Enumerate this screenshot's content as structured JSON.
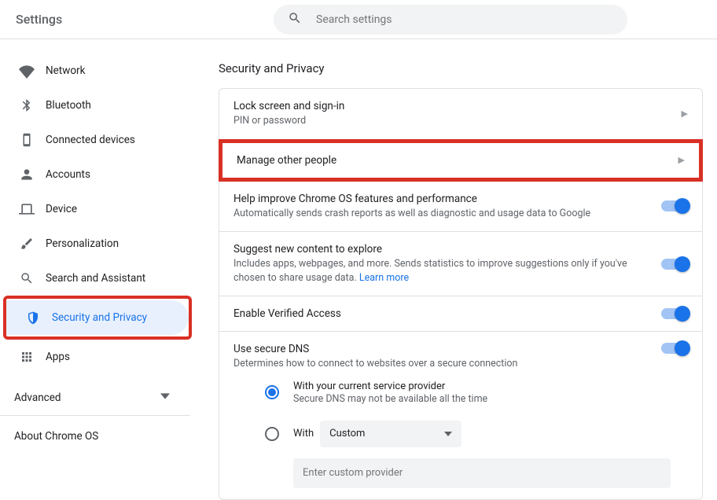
{
  "header": {
    "title": "Settings",
    "search_placeholder": "Search settings"
  },
  "sidebar": {
    "items": [
      {
        "label": "Network"
      },
      {
        "label": "Bluetooth"
      },
      {
        "label": "Connected devices"
      },
      {
        "label": "Accounts"
      },
      {
        "label": "Device"
      },
      {
        "label": "Personalization"
      },
      {
        "label": "Search and Assistant"
      },
      {
        "label": "Security and Privacy"
      },
      {
        "label": "Apps"
      }
    ],
    "advanced": "Advanced",
    "about": "About Chrome OS"
  },
  "section_title": "Security and Privacy",
  "rows": {
    "lock": {
      "title": "Lock screen and sign-in",
      "sub": "PIN or password"
    },
    "manage": {
      "title": "Manage other people"
    },
    "improve": {
      "title": "Help improve Chrome OS features and performance",
      "sub": "Automatically sends crash reports as well as diagnostic and usage data to Google"
    },
    "suggest": {
      "title": "Suggest new content to explore",
      "sub": "Includes apps, webpages, and more. Sends statistics to improve suggestions only if you've chosen to share usage data.  ",
      "link": "Learn more"
    },
    "verified": {
      "title": "Enable Verified Access"
    },
    "dns": {
      "title": "Use secure DNS",
      "sub": "Determines how to connect to websites over a secure connection"
    }
  },
  "dns_options": {
    "current": {
      "title": "With your current service provider",
      "sub": "Secure DNS may not be available all the time"
    },
    "custom_label": "With",
    "custom_select": "Custom",
    "custom_placeholder": "Enter custom provider"
  }
}
